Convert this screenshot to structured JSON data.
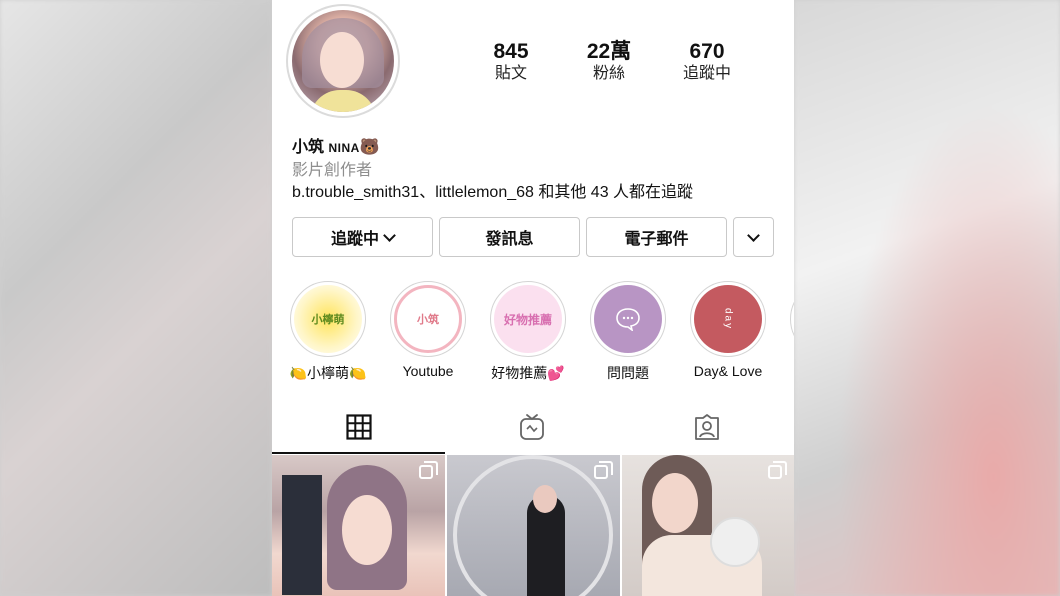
{
  "stats": {
    "posts": {
      "value": "845",
      "label": "貼文"
    },
    "followers": {
      "value": "22萬",
      "label": "粉絲"
    },
    "following": {
      "value": "670",
      "label": "追蹤中"
    }
  },
  "profile": {
    "name": "小筑",
    "name_latin": "NINA",
    "name_emoji": "🐻",
    "category": "影片創作者",
    "followed_by": "b.trouble_smith31、littlelemon_68 和其他 43 人都在追蹤"
  },
  "buttons": {
    "following": "追蹤中",
    "message": "發訊息",
    "email": "電子郵件"
  },
  "highlights": [
    {
      "label": "🍋小檸萌🍋",
      "cover_text": "小檸萌",
      "color": "#fff3b0"
    },
    {
      "label": "Youtube",
      "cover_text": "小筑",
      "color": "#ffffff"
    },
    {
      "label": "好物推薦💕",
      "cover_text": "好物推薦",
      "color": "#fbe0ef"
    },
    {
      "label": "問問題",
      "cover_text": "",
      "color": "#b895c4"
    },
    {
      "label": "Day& Love",
      "cover_text": "day",
      "color": "#c45a60"
    }
  ],
  "tabs": {
    "grid_icon": "grid-icon",
    "igtv_icon": "igtv-icon",
    "tagged_icon": "tagged-icon"
  }
}
